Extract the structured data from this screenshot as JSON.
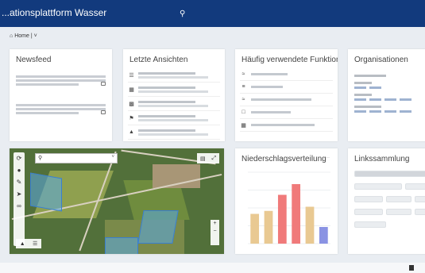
{
  "topbar": {
    "title": "...ationsplattform Wasser",
    "search_icon": "search-icon",
    "search_label": "",
    "user_line1": "",
    "user_line2": ""
  },
  "breadcrumb": {
    "home": "Home",
    "separator": "|",
    "current": ""
  },
  "cards": {
    "news": {
      "title": "Newsfeed",
      "items": [
        {
          "date": "",
          "author": "",
          "link": "",
          "icon": "document-icon"
        },
        {
          "date": "",
          "author": "",
          "link": "",
          "icon": "document-icon"
        }
      ]
    },
    "recent": {
      "title": "Letzte Ansichten",
      "items": [
        {
          "icon": "list-icon",
          "line1": "",
          "line2": ""
        },
        {
          "icon": "table-icon",
          "line1": "",
          "line2": ""
        },
        {
          "icon": "grid-icon",
          "line1": "",
          "line2": ""
        },
        {
          "icon": "map-pin-icon",
          "line1": "",
          "line2": ""
        },
        {
          "icon": "chart-icon",
          "line1": "",
          "line2": ""
        }
      ]
    },
    "frequent": {
      "title": "Häufig verwendete Funktionen",
      "items": [
        {
          "icon": "water-icon",
          "label": ""
        },
        {
          "icon": "search-list-icon",
          "label": ""
        },
        {
          "icon": "water-search-icon",
          "label": ""
        },
        {
          "icon": "document-icon",
          "label": ""
        },
        {
          "icon": "grid-icon",
          "label": ""
        }
      ]
    },
    "orgs": {
      "title": "Organisationen"
    },
    "map": {
      "search_value": "",
      "tools": [
        "layers-icon",
        "info-icon",
        "pencil-icon",
        "cursor-icon",
        "measure-icon"
      ],
      "top_controls": [
        "layers-stack-icon",
        "expand-icon"
      ],
      "zoom_in": "+",
      "zoom_out": "−",
      "bottom_controls": [
        "home-icon",
        "list-icon"
      ]
    },
    "chart": {
      "title": "Niederschlagsverteilung",
      "more": "···"
    },
    "links": {
      "title": "Linkssammlung",
      "pills": [
        "",
        "",
        "",
        "",
        "",
        "",
        "",
        "",
        "",
        ""
      ]
    }
  },
  "chart_data": {
    "type": "bar",
    "categories": [
      "",
      "",
      "",
      "",
      "",
      ""
    ],
    "values": [
      50,
      55,
      82,
      100,
      62,
      28
    ],
    "highlight": [
      2,
      3
    ],
    "ylim": [
      0,
      120
    ],
    "colors": {
      "default": "#e9c992",
      "highlight": "#f07a7a",
      "last": "#8a93e3"
    }
  },
  "colors": {
    "header": "#123a7d",
    "background": "#e9edf2",
    "link": "#1d4f9a"
  }
}
